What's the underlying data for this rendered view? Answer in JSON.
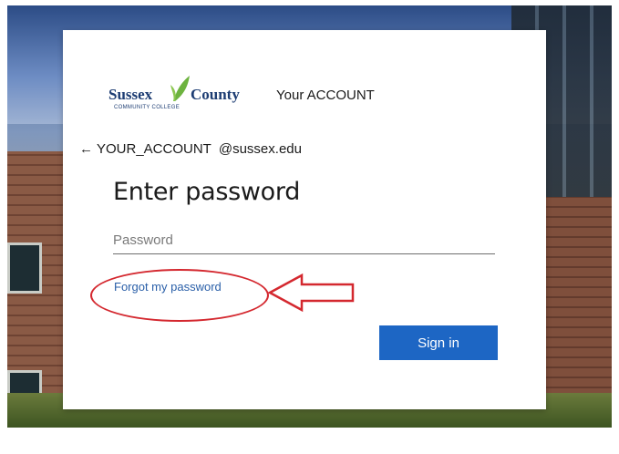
{
  "logo": {
    "word1": "Sussex",
    "word2": "County",
    "subtitle": "COMMUNITY COLLEGE",
    "brand_color": "#1d3d73",
    "leaf_color": "#6db33f"
  },
  "header": {
    "account_label": "Your ACCOUNT"
  },
  "identity": {
    "back_icon": "left-arrow-icon",
    "username": "YOUR_ACCOUNT",
    "domain": "@sussex.edu"
  },
  "form": {
    "title": "Enter password",
    "password_placeholder": "Password",
    "password_value": "",
    "forgot_link": "Forgot my password",
    "signin_label": "Sign in"
  },
  "colors": {
    "link": "#2a5fa8",
    "primary_button": "#1d66c4",
    "annotation": "#d4282f"
  }
}
